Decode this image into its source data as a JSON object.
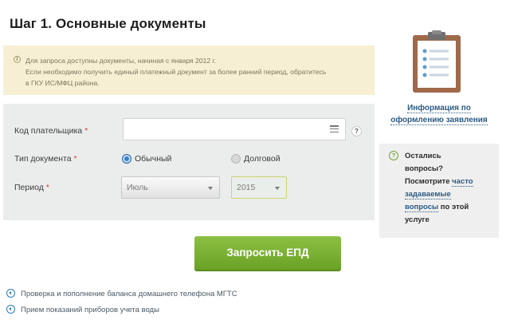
{
  "page_title": "Шаг 1. Основные документы",
  "notice": {
    "line1": "Для запроса доступны документы, начиная с января 2012 г.",
    "line2": "Если необходимо получить единый платежный документ за более ранний период, обратитесь",
    "line3": "в ГКУ ИС/МФЦ района.",
    "icon_glyph": "i"
  },
  "form": {
    "payer_code_label": "Код плательщика",
    "doc_type_label": "Тип документа",
    "period_label": "Период",
    "required_mark": "*",
    "payer_code_value": "",
    "help_glyph": "?",
    "doc_type_options": [
      {
        "label": "Обычный",
        "selected": true
      },
      {
        "label": "Долговой",
        "selected": false
      }
    ],
    "month_value": "Июль",
    "year_value": "2015"
  },
  "submit_label": "Запросить ЕПД",
  "links": [
    "Проверка и пополнение баланса домашнего телефона МГТС",
    "Прием показаний приборов учета воды"
  ],
  "sidebar": {
    "info_link_line1": "Информация по",
    "info_link_line2": "оформлению заявления",
    "questions": {
      "line1": "Остались",
      "line2": "вопросы?",
      "line3_prefix": "Посмотрите",
      "link_part1": "часто",
      "link_part2": "задаваемые",
      "link_part3": "вопросы",
      "line5_suffix": "по этой",
      "line6": "услуге",
      "icon_glyph": "?"
    }
  },
  "colors": {
    "accent_green": "#7ab334",
    "link_blue": "#2c5b83",
    "notice_bg": "#f6efd3",
    "required_red": "#d3423b"
  },
  "icons": [
    "info-icon",
    "menu-icon",
    "help-icon",
    "clipboard-icon",
    "question-icon",
    "arrow-circle-icon"
  ]
}
